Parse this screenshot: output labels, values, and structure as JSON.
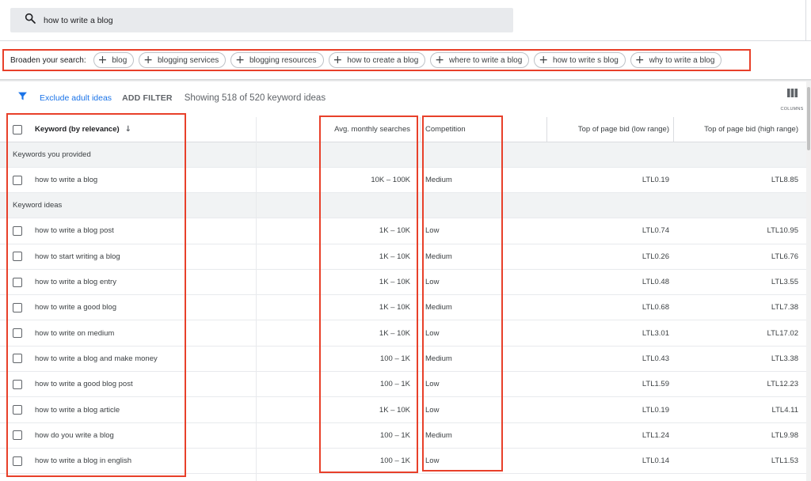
{
  "search": {
    "query": "how to write a blog",
    "icon": "search-icon"
  },
  "broaden": {
    "label": "Broaden your search:",
    "chips": [
      "blog",
      "blogging services",
      "blogging resources",
      "how to create a blog",
      "where to write a blog",
      "how to write s blog",
      "why to write a blog"
    ]
  },
  "toolbar": {
    "exclude_label": "Exclude adult ideas",
    "add_filter_label": "ADD FILTER",
    "showing_text": "Showing 518 of 520 keyword ideas",
    "columns_label": "COLUMNS"
  },
  "table": {
    "headers": {
      "keyword": "Keyword (by relevance)",
      "avg_searches": "Avg. monthly searches",
      "competition": "Competition",
      "bid_low": "Top of page bid (low range)",
      "bid_high": "Top of page bid (high range)"
    },
    "provided_group_label": "Keywords you provided",
    "provided": [
      {
        "keyword": "how to write a blog",
        "avg": "10K – 100K",
        "competition": "Medium",
        "low": "LTL0.19",
        "high": "LTL8.85"
      }
    ],
    "ideas_group_label": "Keyword ideas",
    "ideas": [
      {
        "keyword": "how to write a blog post",
        "avg": "1K – 10K",
        "competition": "Low",
        "low": "LTL0.74",
        "high": "LTL10.95"
      },
      {
        "keyword": "how to start writing a blog",
        "avg": "1K – 10K",
        "competition": "Medium",
        "low": "LTL0.26",
        "high": "LTL6.76"
      },
      {
        "keyword": "how to write a blog entry",
        "avg": "1K – 10K",
        "competition": "Low",
        "low": "LTL0.48",
        "high": "LTL3.55"
      },
      {
        "keyword": "how to write a good blog",
        "avg": "1K – 10K",
        "competition": "Medium",
        "low": "LTL0.68",
        "high": "LTL7.38"
      },
      {
        "keyword": "how to write on medium",
        "avg": "1K – 10K",
        "competition": "Low",
        "low": "LTL3.01",
        "high": "LTL17.02"
      },
      {
        "keyword": "how to write a blog and make money",
        "avg": "100 – 1K",
        "competition": "Medium",
        "low": "LTL0.43",
        "high": "LTL3.38"
      },
      {
        "keyword": "how to write a good blog post",
        "avg": "100 – 1K",
        "competition": "Low",
        "low": "LTL1.59",
        "high": "LTL12.23"
      },
      {
        "keyword": "how to write a blog article",
        "avg": "1K – 10K",
        "competition": "Low",
        "low": "LTL0.19",
        "high": "LTL4.11"
      },
      {
        "keyword": "how do you write a blog",
        "avg": "100 – 1K",
        "competition": "Medium",
        "low": "LTL1.24",
        "high": "LTL9.98"
      },
      {
        "keyword": "how to write a blog in english",
        "avg": "100 – 1K",
        "competition": "Low",
        "low": "LTL0.14",
        "high": "LTL1.53"
      }
    ]
  },
  "colors": {
    "accent": "#1a73e8",
    "highlight": "#e8402a",
    "group_bg": "#f1f3f4"
  }
}
